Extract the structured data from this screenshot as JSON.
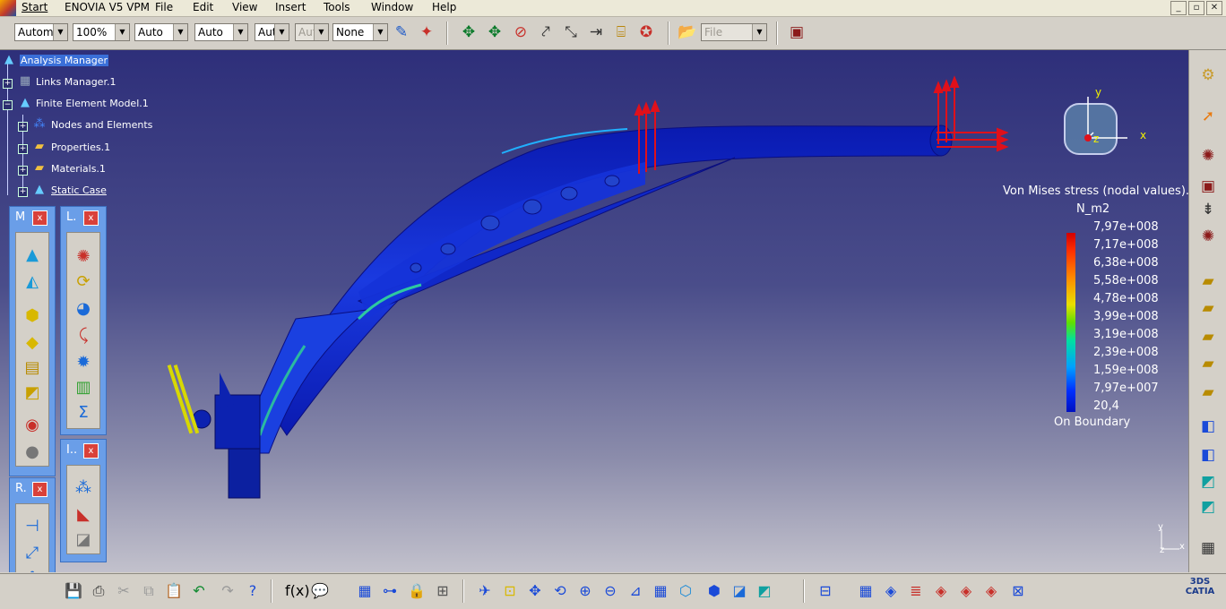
{
  "menubar": {
    "items": [
      "Start",
      "ENOVIA V5 VPM",
      "File",
      "Edit",
      "View",
      "Insert",
      "Tools",
      "Window",
      "Help"
    ],
    "window_controls": [
      "_",
      "▫",
      "✕"
    ]
  },
  "toolbar": {
    "combos": [
      {
        "value": "Automa",
        "disabled": false
      },
      {
        "value": "100%",
        "disabled": false
      },
      {
        "value": "Auto",
        "disabled": false
      },
      {
        "value": "Auto",
        "disabled": false
      },
      {
        "value": "Aut",
        "disabled": false
      },
      {
        "value": "Aut",
        "disabled": true
      },
      {
        "value": "None",
        "disabled": false
      }
    ],
    "file_combo": "File"
  },
  "tree": {
    "items": [
      {
        "label": "Analysis Manager",
        "icon": "analysis-manager-icon",
        "selected": true
      },
      {
        "label": "Links Manager.1",
        "icon": "links-manager-icon"
      },
      {
        "label": "Finite Element Model.1",
        "icon": "finite-element-model-icon"
      },
      {
        "label": "Nodes and Elements",
        "icon": "nodes-elements-icon"
      },
      {
        "label": "Properties.1",
        "icon": "folder-icon"
      },
      {
        "label": "Materials.1",
        "icon": "folder-icon"
      },
      {
        "label": "Static Case",
        "icon": "static-case-icon"
      }
    ]
  },
  "panels": {
    "m": {
      "title": "M",
      "close": "x"
    },
    "l": {
      "title": "L.",
      "close": "x"
    },
    "i": {
      "title": "I..",
      "close": "x"
    },
    "r": {
      "title": "R.",
      "close": "x"
    }
  },
  "compass": {
    "x": "x",
    "y": "y",
    "z": "z"
  },
  "mini_axes": {
    "x": "x",
    "y": "y",
    "z": "z"
  },
  "legend": {
    "title": "Von Mises stress (nodal values).",
    "unit": "N_m2",
    "values": [
      "7,97e+008",
      "7,17e+008",
      "6,38e+008",
      "5,58e+008",
      "4,78e+008",
      "3,99e+008",
      "3,19e+008",
      "2,39e+008",
      "1,59e+008",
      "7,97e+007",
      "20,4"
    ],
    "boundary": "On Boundary"
  },
  "colors": {
    "viewport_top": "#2e2f7a",
    "viewport_bottom": "#c2c1cc",
    "panel": "#6a9ee8",
    "part": "#1a2fd0",
    "load_arrow": "#e0101a"
  }
}
